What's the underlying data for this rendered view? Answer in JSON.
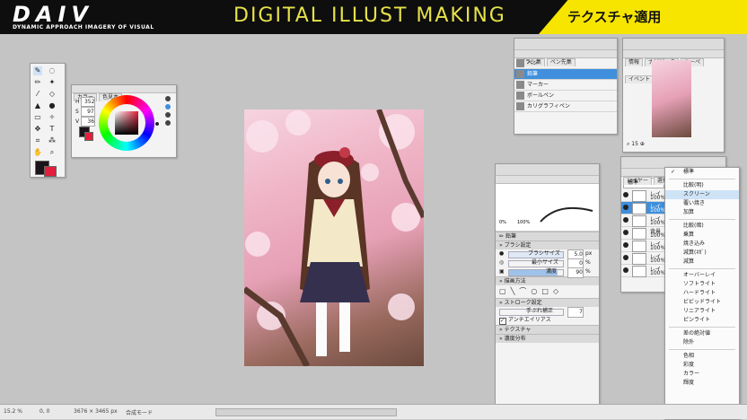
{
  "banner": {
    "logo": "DAIV",
    "logo_sub": "DYNAMIC APPROACH IMAGERY OF VISUAL",
    "title": "DIGITAL ILLUST MAKING",
    "tag": "テクスチャ適用"
  },
  "color_panel": {
    "tabs": [
      "カラー",
      "色見本"
    ],
    "h_label": "H",
    "h_value": "352",
    "s_label": "S",
    "s_value": "97",
    "v_label": "V",
    "v_value": "36"
  },
  "brush_panel": {
    "tabs": [
      "ブラシ集",
      "ペン先集"
    ],
    "items": [
      "ペン",
      "鉛筆",
      "マーカー",
      "ボールペン",
      "カリグラフィペン"
    ],
    "selected_index": 1
  },
  "navigator_panel": {
    "tabs": [
      "情報",
      "ナビゲータ",
      "ルーペ",
      "イベント"
    ],
    "zoom": "15"
  },
  "brush_settings": {
    "tab": "鉛筆",
    "preview_min": "0%",
    "preview_max": "100%",
    "name": "鉛筆",
    "section_brush": "ブラシ設定",
    "brush_size_label": "ブラシサイズ",
    "brush_size_value": "5.0",
    "brush_size_unit": "px",
    "min_size_label": "最小サイズ",
    "min_size_value": "0",
    "min_size_unit": "%",
    "density_label": "濃度",
    "density_value": "90",
    "density_unit": "%",
    "section_draw": "描画方法",
    "section_stroke": "ストローク設定",
    "stabilizer_label": "手ぶれ補正",
    "stabilizer_value": "7",
    "antialias_label": "アンチエイリアス",
    "section_texture": "テクスチャ",
    "section_density": "濃度分布"
  },
  "layer_panel": {
    "tabs": [
      "レイヤー",
      "選択範囲"
    ],
    "blend_value": "標準",
    "rows": [
      {
        "name": "レイ",
        "opacity": "100%"
      },
      {
        "name": "レイ",
        "opacity": "100%"
      },
      {
        "name": "レイ",
        "opacity": "100%"
      },
      {
        "name": "背景",
        "opacity": "100%"
      },
      {
        "name": "レイ",
        "opacity": "100%"
      },
      {
        "name": "レイ",
        "opacity": "100%"
      },
      {
        "name": "レイ",
        "opacity": "100%"
      }
    ]
  },
  "blend_menu": {
    "items": [
      "標準",
      "比較(明)",
      "スクリーン",
      "覆い焼き",
      "加算",
      "比較(暗)",
      "乗算",
      "焼き込み",
      "減算(ﾈｶﾞ)",
      "減算",
      "オーバーレイ",
      "ソフトライト",
      "ハードライト",
      "ビビッドライト",
      "リニアライト",
      "ピンライト",
      "差の絶対値",
      "除外",
      "色相",
      "彩度",
      "カラー",
      "輝度"
    ],
    "checked_index": 0,
    "highlighted_index": 2
  },
  "statusbar": {
    "zoom": "15.2 %",
    "coords": "0, 0",
    "size": "3676 × 3465 px",
    "mode": "合成モード"
  },
  "colors": {
    "accent": "#3f8fdd",
    "banner_bg": "#0e0e0e",
    "banner_title": "#e6e24a",
    "banner_tag": "#f7e500",
    "fg_color": "#1a1418",
    "bg_color": "#e0203c"
  }
}
